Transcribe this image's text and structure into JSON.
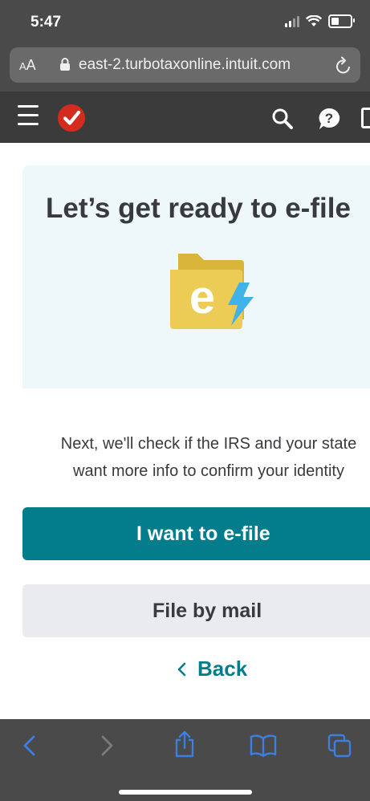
{
  "status": {
    "time": "5:47"
  },
  "browser": {
    "aa_small": "A",
    "aa_large": "A",
    "url": "east-2.turbotaxonline.intuit.com"
  },
  "page": {
    "title": "Let’s get ready to e-file",
    "folder_letter": "e",
    "info_line1": "Next, we'll check if the IRS and your state",
    "info_line2": "want more info to confirm your identity",
    "efile_button": "I want to e-file",
    "mail_button": "File by mail",
    "back_label": "Back"
  },
  "colors": {
    "accent": "#037c8c",
    "hero_bg": "#eef8fa",
    "logo_red": "#d52b1e",
    "folder_yellow": "#e8c84a",
    "bolt_blue": "#3fb2e8",
    "safari_blue": "#3d7fe0"
  },
  "icons": [
    "lock-icon",
    "reload-icon",
    "menu-icon",
    "turbotax-logo",
    "search-icon",
    "help-icon",
    "efile-folder-icon",
    "chevron-left-icon",
    "share-icon",
    "bookmarks-icon",
    "tabs-icon"
  ]
}
